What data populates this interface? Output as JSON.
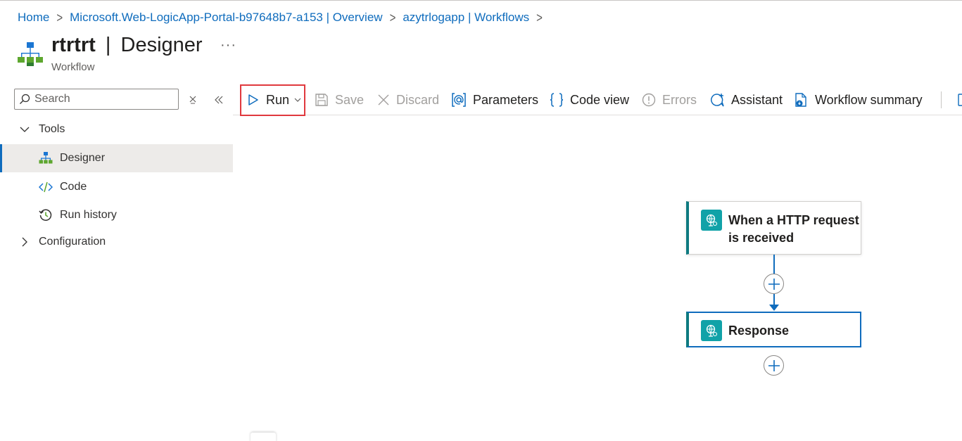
{
  "breadcrumb": [
    "Home",
    "Microsoft.Web-LogicApp-Portal-b97648b7-a153 | Overview",
    "azytrlogapp | Workflows"
  ],
  "header": {
    "name": "rtrtrt",
    "separator": "|",
    "page": "Designer",
    "subtitle": "Workflow",
    "more": "···"
  },
  "sidebar": {
    "search_placeholder": "Search",
    "groups": [
      {
        "label": "Tools",
        "expanded": true,
        "items": [
          {
            "label": "Designer",
            "icon": "designer-icon",
            "active": true
          },
          {
            "label": "Code",
            "icon": "code-icon",
            "active": false
          },
          {
            "label": "Run history",
            "icon": "run-history-icon",
            "active": false
          }
        ]
      },
      {
        "label": "Configuration",
        "expanded": false,
        "items": []
      }
    ]
  },
  "toolbar": {
    "run": "Run",
    "save": "Save",
    "discard": "Discard",
    "parameters": "Parameters",
    "code_view": "Code view",
    "errors": "Errors",
    "assistant": "Assistant",
    "workflow_summary": "Workflow summary"
  },
  "designer": {
    "trigger": "When a HTTP request is received",
    "trigger_lines": [
      "When a HTTP request",
      "is received"
    ],
    "action": "Response"
  },
  "colors": {
    "link": "#0f6cbd",
    "highlight": "#e0393e",
    "card_accent": "#0e7a80",
    "card_icon_bg": "#11a2a8"
  }
}
